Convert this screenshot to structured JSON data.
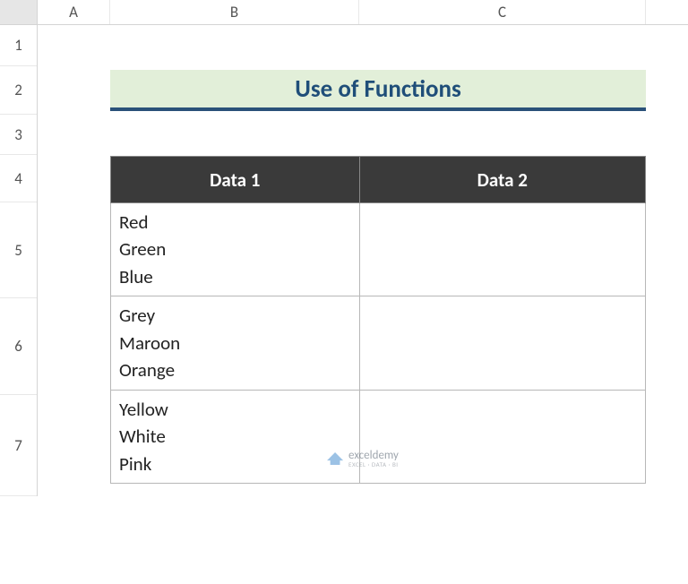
{
  "columns": {
    "A": "A",
    "B": "B",
    "C": "C"
  },
  "rows": {
    "r1": "1",
    "r2": "2",
    "r3": "3",
    "r4": "4",
    "r5": "5",
    "r6": "6",
    "r7": "7"
  },
  "title": "Use of Functions",
  "headers": {
    "data1": "Data 1",
    "data2": "Data 2"
  },
  "cells": {
    "b5": "Red\nGreen\nBlue",
    "b6": "Grey\nMaroon\nOrange",
    "b7": "Yellow\nWhite\nPink",
    "c5": "",
    "c6": "",
    "c7": ""
  },
  "watermark": {
    "brand": "exceldemy",
    "tag": "EXCEL · DATA · BI"
  }
}
